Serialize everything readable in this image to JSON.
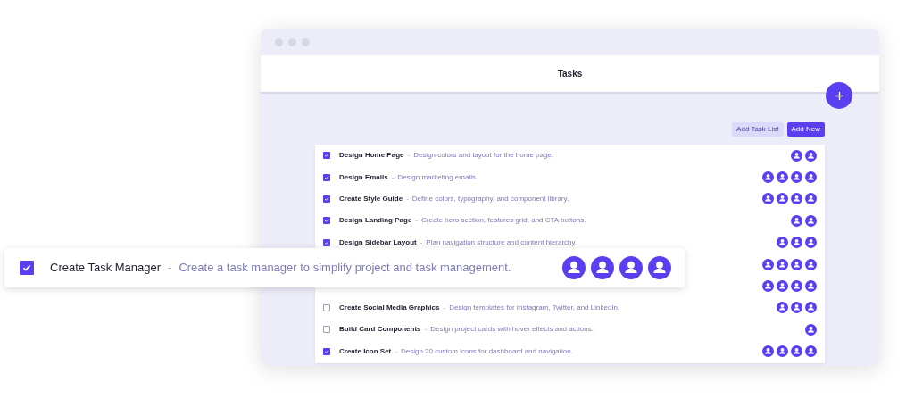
{
  "window": {
    "title": "Tasks"
  },
  "toolbar": {
    "buttons": [
      {
        "label": "Add Task List",
        "kind": "secondary"
      },
      {
        "label": "Add New",
        "kind": "primary"
      }
    ]
  },
  "tasks": [
    {
      "title": "Design Home Page",
      "separator": "-",
      "description": "Design colors and layout for the home page.",
      "checked": true,
      "assignees": [
        {
          "kind": "avatar"
        },
        {
          "kind": "avatar"
        }
      ]
    },
    {
      "title": "Design Emails",
      "separator": "-",
      "description": "Design marketing emails.",
      "checked": true,
      "assignees": [
        {
          "kind": "avatar"
        },
        {
          "kind": "avatar"
        },
        {
          "kind": "avatar"
        },
        {
          "kind": "avatar"
        }
      ]
    },
    {
      "title": "Create Style Guide",
      "separator": "-",
      "description": "Define colors, typography, and component library.",
      "checked": true,
      "assignees": [
        {
          "kind": "avatar"
        },
        {
          "kind": "avatar"
        },
        {
          "kind": "avatar"
        },
        {
          "kind": "avatar"
        }
      ]
    },
    {
      "title": "Design Landing Page",
      "separator": "-",
      "description": "Create hero section, features grid, and CTA buttons.",
      "checked": true,
      "assignees": [
        {
          "kind": "avatar"
        },
        {
          "kind": "avatar"
        }
      ]
    },
    {
      "title": "Design Sidebar Layout",
      "separator": "-",
      "description": "Plan navigation structure and content hierarchy.",
      "checked": true,
      "assignees": [
        {
          "kind": "avatar"
        },
        {
          "kind": "avatar"
        },
        {
          "kind": "avatar"
        }
      ]
    },
    {
      "assignees": [
        {
          "kind": "avatar"
        },
        {
          "kind": "avatar"
        },
        {
          "kind": "avatar"
        },
        {
          "kind": "avatar"
        }
      ]
    },
    {
      "assignees": [
        {
          "kind": "avatar"
        },
        {
          "kind": "avatar"
        },
        {
          "kind": "avatar"
        },
        {
          "kind": "avatar"
        }
      ]
    },
    {
      "title": "Create Social Media Graphics",
      "separator": "-",
      "description": "Design templates for Instagram, Twitter, and LinkedIn.",
      "checked": false,
      "assignees": [
        {
          "kind": "avatar"
        },
        {
          "kind": "avatar"
        },
        {
          "kind": "avatar"
        }
      ]
    },
    {
      "title": "Build Card Components",
      "separator": "-",
      "description": "Design project cards with hover effects and actions.",
      "checked": false,
      "assignees": [
        {
          "kind": "avatar"
        }
      ]
    },
    {
      "title": "Create Icon Set",
      "separator": "-",
      "description": "Design 20 custom icons for dashboard and navigation.",
      "checked": true,
      "assignees": [
        {
          "kind": "avatar"
        },
        {
          "kind": "avatar"
        },
        {
          "kind": "avatar"
        },
        {
          "kind": "avatar"
        }
      ]
    }
  ],
  "floating_task": {
    "title": "Create Task Manager",
    "separator": "-",
    "description": "Create a task manager to simplify project and task management.",
    "checked": true,
    "assignees": [
      {
        "kind": "avatar"
      },
      {
        "kind": "avatar"
      },
      {
        "kind": "avatar"
      },
      {
        "kind": "avatar"
      }
    ]
  }
}
